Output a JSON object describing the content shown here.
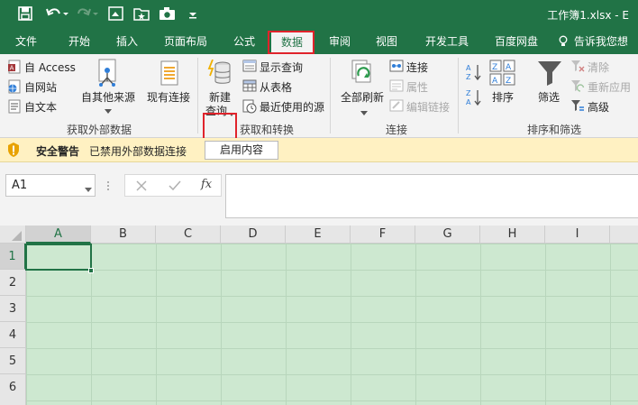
{
  "window": {
    "title": "工作簿1.xlsx - E"
  },
  "tabs": [
    {
      "label": "文件"
    },
    {
      "label": "开始"
    },
    {
      "label": "插入"
    },
    {
      "label": "页面布局"
    },
    {
      "label": "公式"
    },
    {
      "label": "数据"
    },
    {
      "label": "审阅"
    },
    {
      "label": "视图"
    },
    {
      "label": "开发工具"
    },
    {
      "label": "百度网盘"
    }
  ],
  "tell_me": "告诉我您想要",
  "ribbon": {
    "external": {
      "access": "自 Access",
      "web": "自网站",
      "text": "自文本",
      "other": "自其他来源",
      "existing": "现有连接",
      "group": "获取外部数据"
    },
    "transform": {
      "new_query_1": "新建",
      "new_query_2": "查询",
      "show_queries": "显示查询",
      "from_table": "从表格",
      "recent_sources": "最近使用的源",
      "group": "获取和转换"
    },
    "connections": {
      "refresh_all": "全部刷新",
      "connections": "连接",
      "properties": "属性",
      "edit_links": "编辑链接",
      "group": "连接"
    },
    "sort_filter": {
      "sort": "排序",
      "filter": "筛选",
      "clear": "清除",
      "reapply": "重新应用",
      "advanced": "高级",
      "group": "排序和筛选"
    }
  },
  "security": {
    "title": "安全警告",
    "message": "已禁用外部数据连接",
    "button": "启用内容"
  },
  "formula_bar": {
    "name_box": "A1",
    "fx": "fx"
  },
  "grid": {
    "columns": [
      "A",
      "B",
      "C",
      "D",
      "E",
      "F",
      "G",
      "H",
      "I"
    ],
    "rows": [
      "1",
      "2",
      "3",
      "4",
      "5",
      "6"
    ]
  },
  "colors": {
    "brand": "#217346",
    "highlight": "#e0232b",
    "grid_fill": "#cde8d0"
  }
}
